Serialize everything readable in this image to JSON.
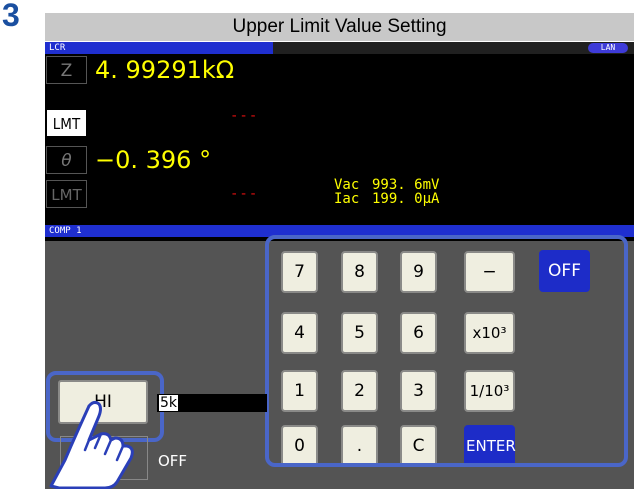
{
  "step": {
    "number": "3"
  },
  "title": "Upper Limit Value Setting",
  "screen": {
    "lcr_header": "LCR",
    "lan_badge": "LAN",
    "params": [
      {
        "name": "Z",
        "value": "4. 99291kΩ",
        "lmt_label": "LMT",
        "judgment": "---"
      },
      {
        "name": "θ",
        "value": "−0. 396 °",
        "lmt_label": "LMT",
        "judgment": "---"
      }
    ],
    "monitor": {
      "vac_label": "Vac",
      "vac_value": "993. 6mV",
      "iac_label": "Iac",
      "iac_value": "199. 0μA"
    },
    "comp_header": "COMP 1",
    "keypad": {
      "row1": [
        "7",
        "8",
        "9",
        "−",
        "OFF"
      ],
      "row2": [
        "4",
        "5",
        "6",
        "x10³"
      ],
      "row3": [
        "1",
        "2",
        "3",
        "1/10³"
      ],
      "row4": [
        "0",
        ".",
        "C",
        "ENTER"
      ]
    },
    "hi_button": "HI",
    "hi_value_input": "5k",
    "lo_value": "OFF"
  },
  "colors": {
    "accent_blue": "#1d2cc8",
    "frame_blue": "#4a66c8",
    "value_yellow": "#ffff00",
    "judge_red": "#e01010"
  }
}
